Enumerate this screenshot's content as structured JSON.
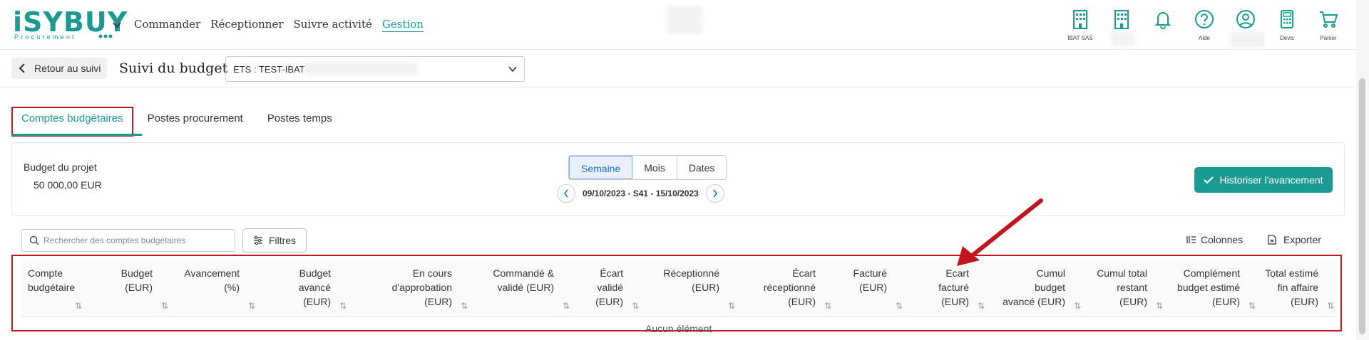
{
  "header": {
    "logo": {
      "brand": "iSYBUY",
      "sub": "Procurement"
    },
    "nav": [
      "Commander",
      "Réceptionner",
      "Suivre activité",
      "Gestion"
    ],
    "nav_active": "Gestion",
    "icons": [
      {
        "name": "building-icon",
        "label": "IBAT SAS"
      },
      {
        "name": "building-icon",
        "label": ""
      },
      {
        "name": "bell-icon",
        "label": ""
      },
      {
        "name": "help-icon",
        "label": "Aide"
      },
      {
        "name": "user-icon",
        "label": ""
      },
      {
        "name": "calculator-icon",
        "label": "Devis"
      },
      {
        "name": "cart-icon",
        "label": "Panier"
      }
    ],
    "accent": "#1a9a92"
  },
  "subbar": {
    "back_label": "Retour au suivi",
    "page_title": "Suivi du budget",
    "ets_value": "ETS : TEST-IBAT"
  },
  "tabs": [
    "Comptes budgétaires",
    "Postes procurement",
    "Postes temps"
  ],
  "budget": {
    "label": "Budget du projet",
    "value": "50 000,00 EUR",
    "periods": [
      "Semaine",
      "Mois",
      "Dates"
    ],
    "period_selected": "Semaine",
    "date_range": "09/10/2023 - S41 - 15/10/2023",
    "historize_label": "Historiser l'avancement"
  },
  "toolbar": {
    "search_placeholder": "Rechercher des comptes budgétaires",
    "filters_label": "Filtres",
    "columns_label": "Colonnes",
    "export_label": "Exporter"
  },
  "table": {
    "columns": [
      [
        "Compte",
        "budgétaire"
      ],
      [
        "Budget",
        "(EUR)"
      ],
      [
        "Avancement",
        "(%)"
      ],
      [
        "Budget",
        "avancé",
        "(EUR)"
      ],
      [
        "En cours",
        "d'approbation",
        "(EUR)"
      ],
      [
        "Commandé &",
        "validé (EUR)"
      ],
      [
        "Écart",
        "validé",
        "(EUR)"
      ],
      [
        "Réceptionné",
        "(EUR)"
      ],
      [
        "Écart",
        "réceptionné",
        "(EUR)"
      ],
      [
        "Facturé",
        "(EUR)"
      ],
      [
        "Ecart",
        "facturé",
        "(EUR)"
      ],
      [
        "Cumul",
        "budget",
        "avancé (EUR)"
      ],
      [
        "Cumul total",
        "restant",
        "(EUR)"
      ],
      [
        "Complément",
        "budget estimé",
        "(EUR)"
      ],
      [
        "Total estimé",
        "fin affaire",
        "(EUR)"
      ]
    ],
    "empty_text": "Aucun élément"
  }
}
